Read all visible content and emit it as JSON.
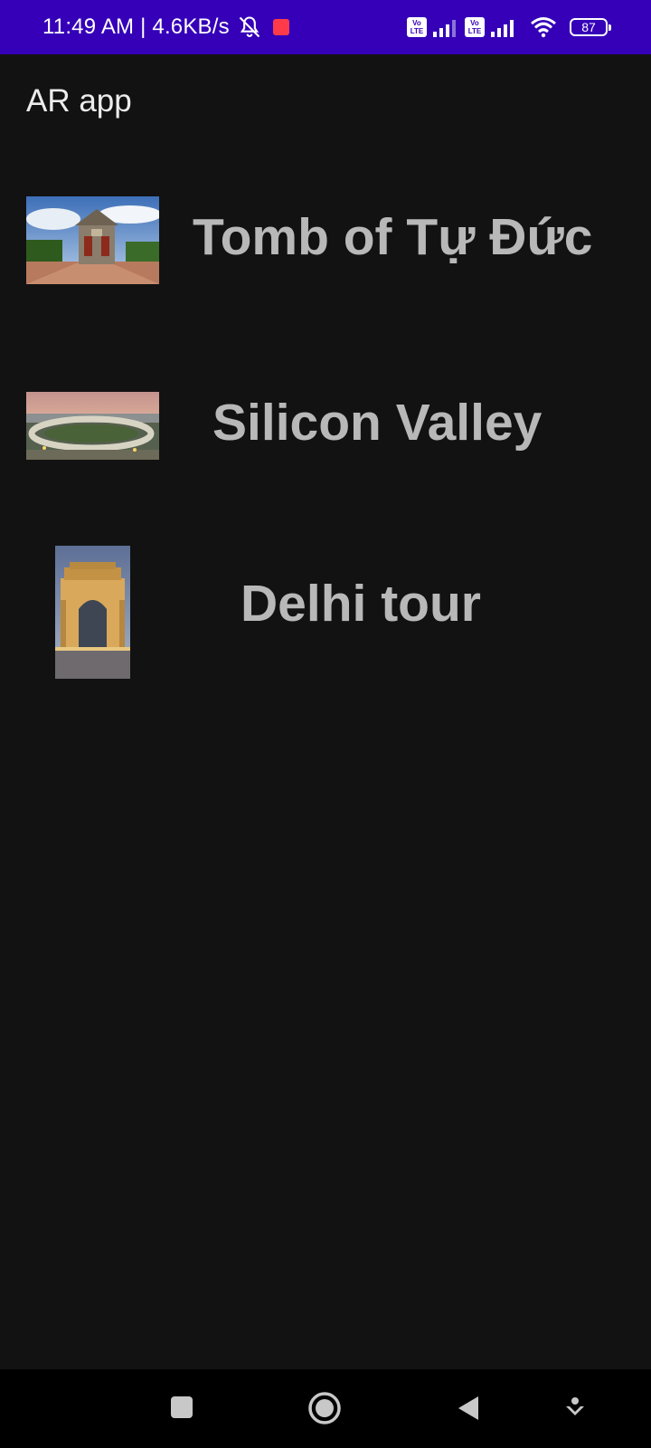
{
  "status_bar": {
    "time_speed": "11:49 AM | 4.6KB/s",
    "volte1": [
      "Vo",
      "LTE"
    ],
    "volte2": [
      "Vo",
      "LTE"
    ],
    "battery": "87",
    "colors": {
      "background": "#3500b8",
      "notification_badge": "#ff3b4a"
    },
    "icons": [
      "bell-off-icon",
      "notification-badge-icon",
      "volte-icon",
      "signal-icon",
      "wifi-icon",
      "battery-icon"
    ]
  },
  "app_bar": {
    "title": "AR app"
  },
  "items": [
    {
      "label": "Tomb of Tự Đức",
      "thumb": "tomb-thumbnail"
    },
    {
      "label": "Silicon Valley",
      "thumb": "silicon-valley-thumbnail"
    },
    {
      "label": "Delhi tour",
      "thumb": "india-gate-thumbnail"
    }
  ],
  "nav_bar": {
    "icons": [
      "recents-square-icon",
      "home-circle-icon",
      "back-triangle-icon",
      "assistant-icon"
    ]
  },
  "colors": {
    "background": "#121212",
    "label": "#b8b8b8",
    "title": "#ececec"
  }
}
